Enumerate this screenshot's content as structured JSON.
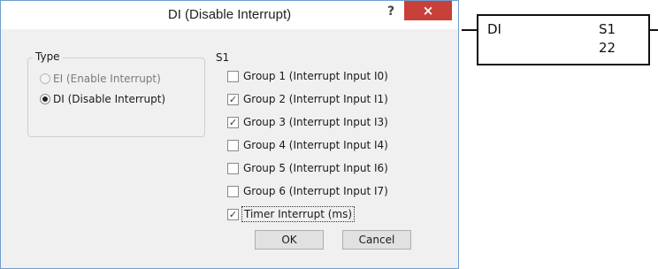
{
  "dialog": {
    "title": "DI (Disable Interrupt)",
    "help_label": "?",
    "close_label": "×"
  },
  "type_group": {
    "legend": "Type",
    "options": [
      {
        "label": "EI (Enable Interrupt)",
        "selected": false,
        "enabled": false
      },
      {
        "label": "DI (Disable Interrupt)",
        "selected": true,
        "enabled": true
      }
    ]
  },
  "s1": {
    "label": "S1",
    "items": [
      {
        "label": "Group 1 (Interrupt Input I0)",
        "checked": false
      },
      {
        "label": "Group 2 (Interrupt Input I1)",
        "checked": true
      },
      {
        "label": "Group 3 (Interrupt Input I3)",
        "checked": true
      },
      {
        "label": "Group 4 (Interrupt Input I4)",
        "checked": false
      },
      {
        "label": "Group 5 (Interrupt Input I6)",
        "checked": false
      },
      {
        "label": "Group 6 (Interrupt Input I7)",
        "checked": false
      },
      {
        "label": "Timer Interrupt (ms)",
        "checked": true
      }
    ]
  },
  "buttons": {
    "ok": "OK",
    "cancel": "Cancel"
  },
  "ladder": {
    "instruction": "DI",
    "operand_label": "S1",
    "operand_value": "22"
  },
  "colors": {
    "close_button": "#c7403a",
    "dialog_bg": "#f0f0f0",
    "frame_border": "#6f9fd0"
  }
}
